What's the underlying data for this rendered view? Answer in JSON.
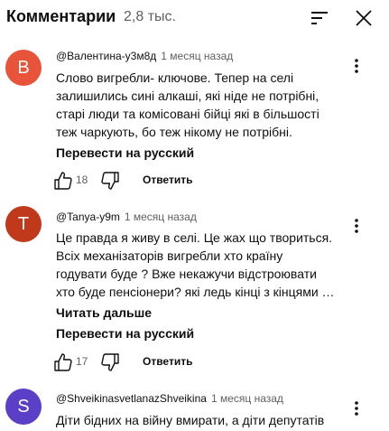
{
  "header": {
    "title": "Комментарии",
    "count": "2,8 тыс."
  },
  "icons": {
    "sort": "sort-icon",
    "close": "close-icon",
    "like": "thumb-up-icon",
    "dislike": "thumb-down-icon",
    "more": "more-vert-icon"
  },
  "comments": [
    {
      "avatar_letter": "В",
      "avatar_color": "#e8543a",
      "author": "@Валентина-у3м8д",
      "time": "1 месяц назад",
      "text_lines": [
        "Слово вигребли- ключове. Тепер на селі",
        "залишились сині алкаші, які ніде не потрібні,",
        "старі люди та комісовані бійці які в більшості",
        "теж чаркують, бо теж нікому не потрібні."
      ],
      "translate": "Перевести на русский",
      "likes": "18",
      "reply": "Ответить"
    },
    {
      "avatar_letter": "T",
      "avatar_color": "#c0391b",
      "author": "@Tanya-y9m",
      "time": "1 месяц назад",
      "text_lines": [
        "Це правда я живу в селі. Це жах що твориться.",
        "Всіх механізаторів вигребли хто країну",
        "годувати буде ? Вже некажучи відстроювати",
        "хто буде пенсіонери? які ледь кінці з кінцями …"
      ],
      "read_more": "Читать дальше",
      "translate": "Перевести на русский",
      "likes": "17",
      "reply": "Ответить"
    },
    {
      "avatar_letter": "S",
      "avatar_color": "#5c3fc7",
      "author": "@ShveikinasvetlanazShveikina",
      "time": "1 месяц назад",
      "text_lines": [
        "Діти бідних на війну вмирати, а діти депутатів"
      ]
    }
  ]
}
